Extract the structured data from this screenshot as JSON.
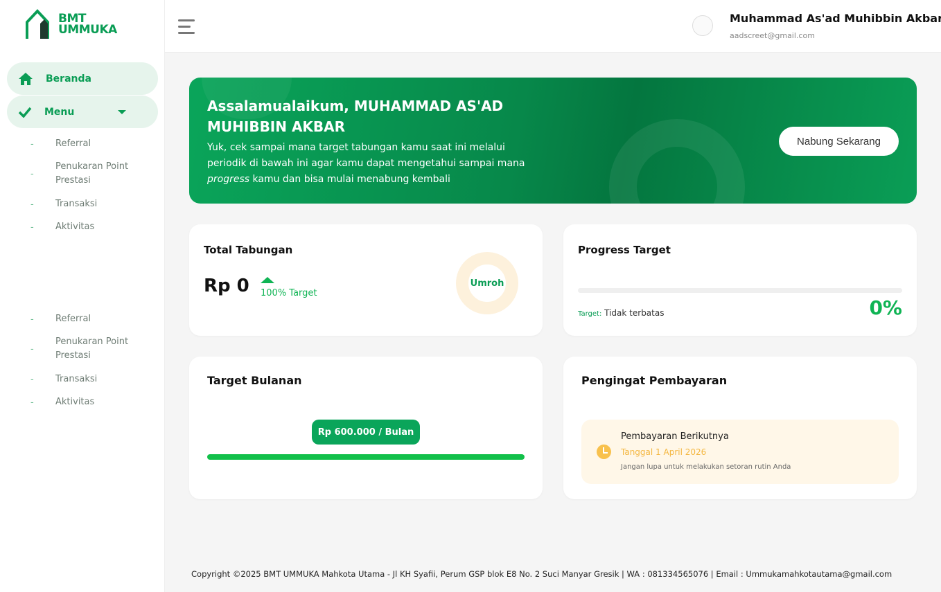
{
  "brand": {
    "logo_text_1": "BMT",
    "logo_text_2": "UMMUKA",
    "color": "#0a9d55"
  },
  "sidebar": {
    "items": [
      {
        "label": "Beranda",
        "icon": "home-icon"
      },
      {
        "label": "Menu",
        "icon": "check-icon"
      }
    ],
    "submenu_a": [
      "Referral",
      "Penukaran Point\nPrestasi",
      "Transaksi",
      "Aktivitas"
    ],
    "submenu_b": [
      "Referral",
      "Penukaran Point\nPrestasi",
      "Transaksi",
      "Aktivitas"
    ],
    "sub_1": "Referral",
    "sub_2_l1": "Penukaran Point",
    "sub_2_l2": "Prestasi",
    "sub_3": "Transaksi",
    "sub_4": "Aktivitas",
    "dash": "-"
  },
  "header": {
    "user_name": "Muhammad As'ad Muhibbin Akbar",
    "user_email": "aadscreet@gmail.com"
  },
  "banner": {
    "greeting": "Assalamualaikum, MUHAMMAD AS'AD MUHIBBIN AKBAR",
    "desc_1": "Yuk, cek sampai mana target tabungan kamu saat ini melalui periodik di bawah ini agar kamu dapat mengetahui sampai mana ",
    "desc_em": "progress",
    "desc_2": " kamu dan bisa mulai menabung kembali",
    "button": "Nabung Sekarang"
  },
  "total_tabungan": {
    "title": "Total Tabungan",
    "amount": "Rp 0",
    "target_text": "100% Target",
    "donut_label": "Umroh"
  },
  "progress_target": {
    "title": "Progress Target",
    "target_key": "Target:",
    "target_value": "Tidak terbatas",
    "percent": "0%",
    "progress_fraction": 0
  },
  "target_bulanan": {
    "title": "Target Bulanan",
    "amount": "Rp 600.000 / Bulan"
  },
  "pengingat": {
    "title": "Pengingat Pembayaran",
    "item_title": "Pembayaran Berikutnya",
    "item_date": "Tanggal 1 April 2026",
    "item_note": "Jangan lupa untuk melakukan setoran rutin Anda"
  },
  "footer": {
    "text": "Copyright ©2025 BMT UMMUKA Mahkota Utama - Jl KH Syafii, Perum GSP blok E8 No. 2 Suci Manyar Gresik | WA : 081334565076 | Email : Ummukamahkotautama@gmail.com"
  }
}
